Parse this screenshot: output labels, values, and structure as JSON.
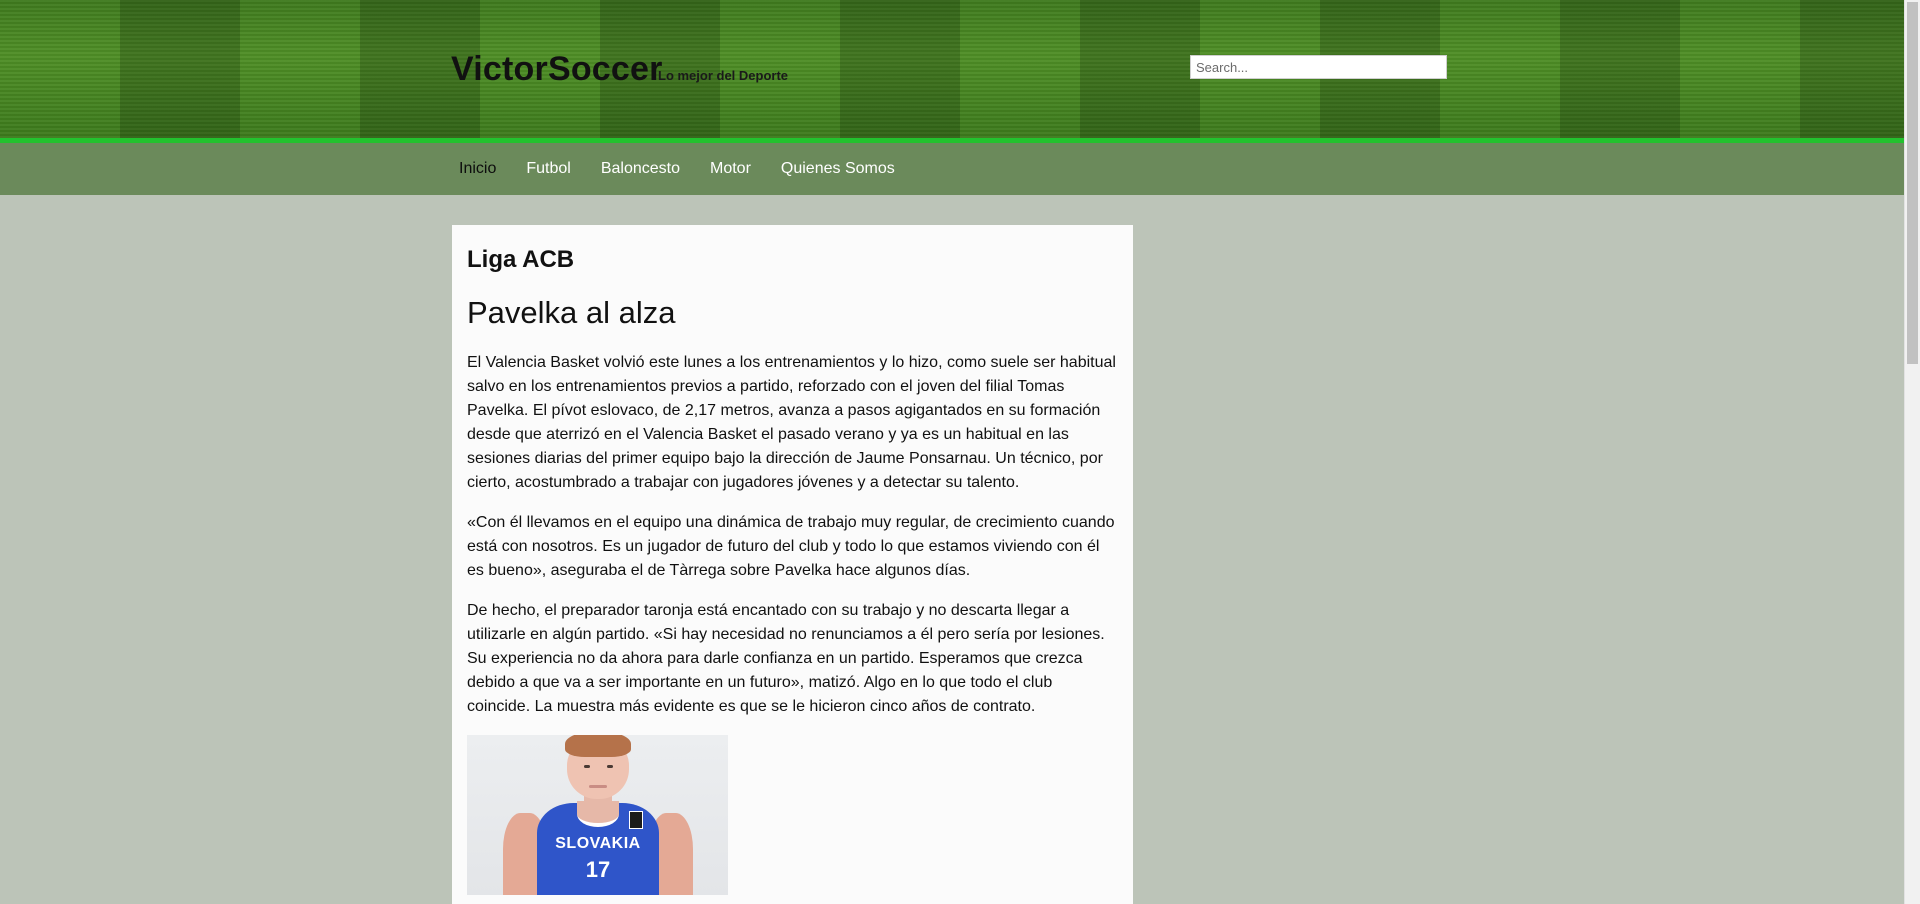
{
  "header": {
    "site_title": "VictorSoccer",
    "tagline": "Lo mejor del Deporte",
    "search_placeholder": "Search..."
  },
  "nav": {
    "items": [
      {
        "label": "Inicio",
        "active": true
      },
      {
        "label": "Futbol",
        "active": false
      },
      {
        "label": "Baloncesto",
        "active": false
      },
      {
        "label": "Motor",
        "active": false
      },
      {
        "label": "Quienes Somos",
        "active": false
      }
    ]
  },
  "article": {
    "section": "Liga ACB",
    "title": "Pavelka al alza",
    "paragraphs": [
      "El Valencia Basket volvió este lunes a los entrenamientos y lo hizo, como suele ser habitual salvo en los entrenamientos previos a partido, reforzado con el joven del filial Tomas Pavelka. El pívot eslovaco, de 2,17 metros, avanza a pasos agigantados en su formación desde que aterrizó en el Valencia Basket el pasado verano y ya es un habitual en las sesiones diarias del primer equipo bajo la dirección de Jaume Ponsarnau. Un técnico, por cierto, acostumbrado a trabajar con jugadores jóvenes y a detectar su talento.",
      "«Con él llevamos en el equipo una dinámica de trabajo muy regular, de crecimiento cuando está con nosotros. Es un jugador de futuro del club y todo lo que estamos viviendo con él es bueno», aseguraba el de Tàrrega sobre Pavelka hace algunos días.",
      "De hecho, el preparador taronja está encantado con su trabajo y no descarta llegar a utilizarle en algún partido. «Si hay necesidad no renunciamos a él pero sería por lesiones. Su experiencia no da ahora para darle confianza en un partido. Esperamos que crezca debido a que va a ser importante en un futuro», matizó. Algo en lo que todo el club coincide. La muestra más evidente es que se le hicieron cinco años de contrato."
    ],
    "image": {
      "jersey_text": "SLOVAKIA",
      "jersey_number": "17"
    }
  },
  "colors": {
    "background": "#bcc4b8",
    "navbar": "#6b8a5b",
    "header_line": "#22c22e",
    "card": "#fbfbfb",
    "jersey": "#2f55c9"
  }
}
